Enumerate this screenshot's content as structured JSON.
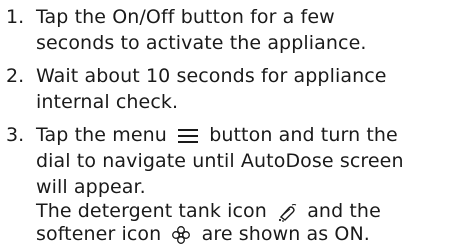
{
  "steps": [
    {
      "number": "1.",
      "lines": [
        "Tap the On/Off button for a few",
        "seconds to activate the appliance."
      ]
    },
    {
      "number": "2.",
      "lines": [
        "Wait about 10 seconds for appliance",
        "internal check."
      ]
    },
    {
      "number": "3.",
      "line1_before_icon": "Tap the menu",
      "line1_after_icon": "button and turn the",
      "line2": "dial to navigate until AutoDose screen",
      "line3": "will appear.",
      "line4_before_icon": "The detergent tank icon",
      "line4_after_icon": "and the",
      "line5_before_icon": "softener icon",
      "line5_after_icon": "are shown as ON.",
      "icons": {
        "menu": "menu-icon",
        "detergent": "detergent-tank-icon",
        "softener": "softener-icon"
      }
    }
  ]
}
